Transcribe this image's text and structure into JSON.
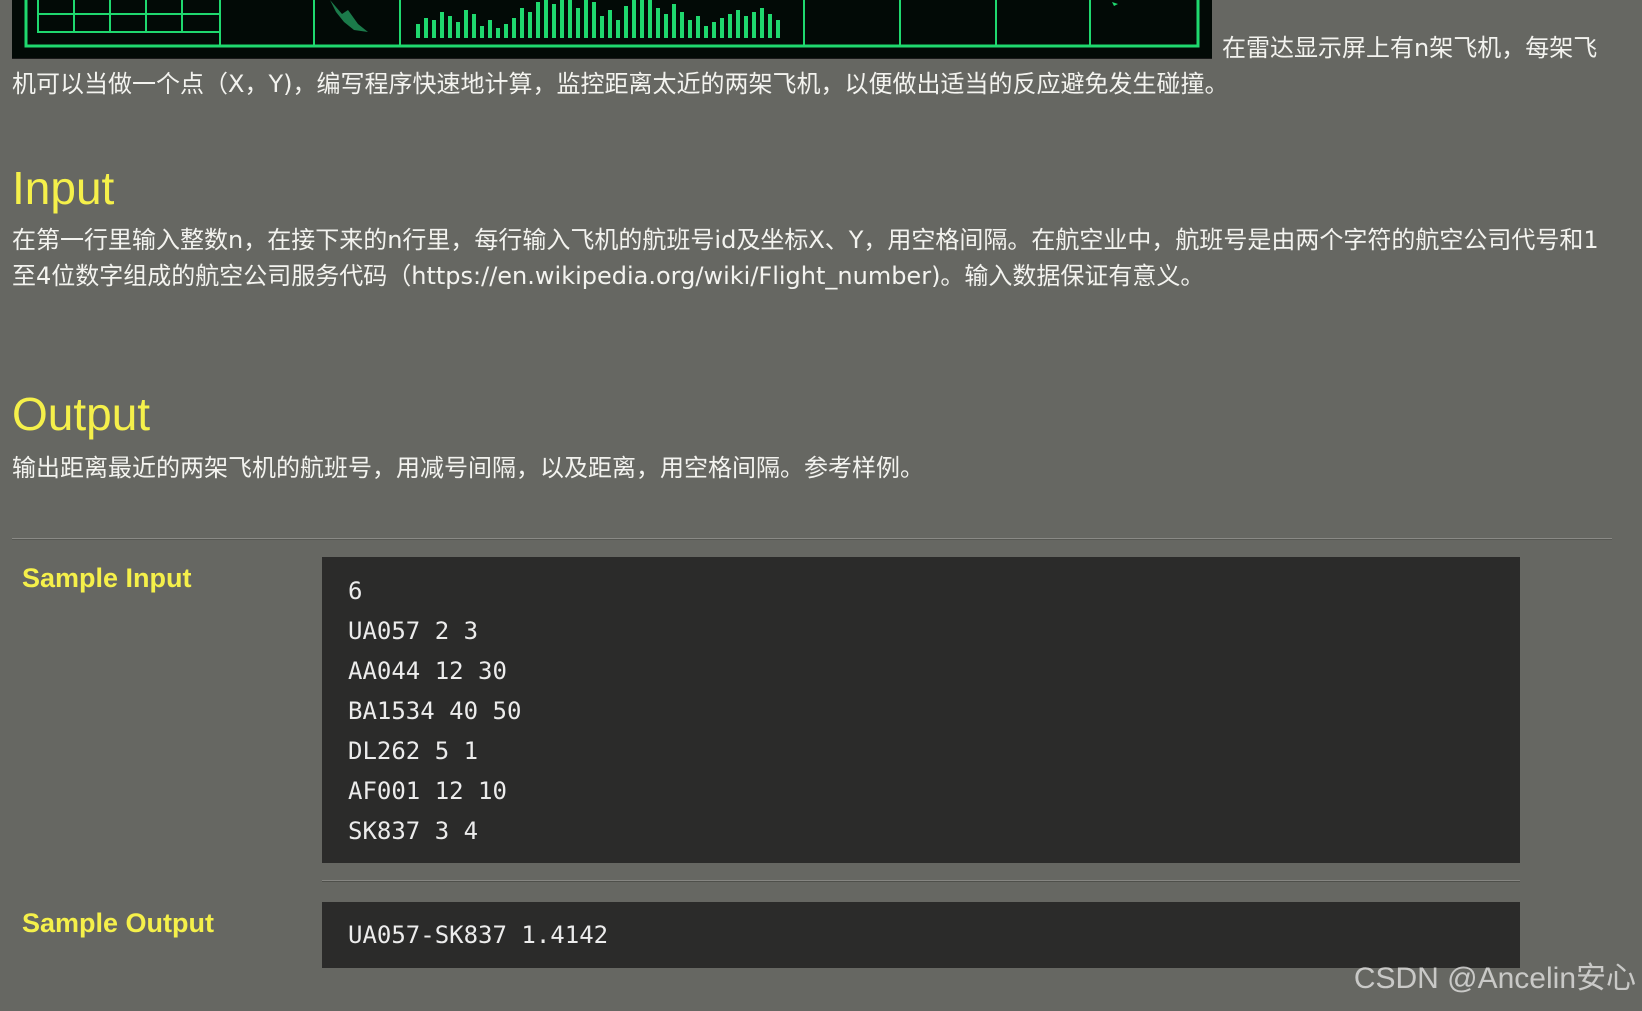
{
  "problem": {
    "description": "在雷达显示屏上有n架飞机，每架飞机可以当做一个点（X，Y)，编写程序快速地计算，监控距离太近的两架飞机，以便做出适当的反应避免发生碰撞。",
    "input_title": "Input",
    "input_desc": "在第一行里输入整数n，在接下来的n行里，每行输入飞机的航班号id及坐标X、Y，用空格间隔。在航空业中，航班号是由两个字符的航空公司代号和1至4位数字组成的航空公司服务代码（https://en.wikipedia.org/wiki/Flight_number)。输入数据保证有意义。",
    "output_title": "Output",
    "output_desc": "输出距离最近的两架飞机的航班号，用减号间隔，以及距离，用空格间隔。参考样例。"
  },
  "sample": {
    "input_label": "Sample Input",
    "input_lines": [
      "6",
      "UA057 2 3",
      "AA044 12 30",
      "BA1534 40 50",
      "DL262 5 1",
      "AF001 12 10",
      "SK837 3 4"
    ],
    "output_label": "Sample Output",
    "output": "UA057-SK837 1.4142"
  },
  "watermark": "CSDN @Ancelin安心",
  "colors": {
    "background": "#666762",
    "heading": "#f5f04a",
    "code_background": "#2b2b2a",
    "radar_green": "#1fd86e"
  }
}
